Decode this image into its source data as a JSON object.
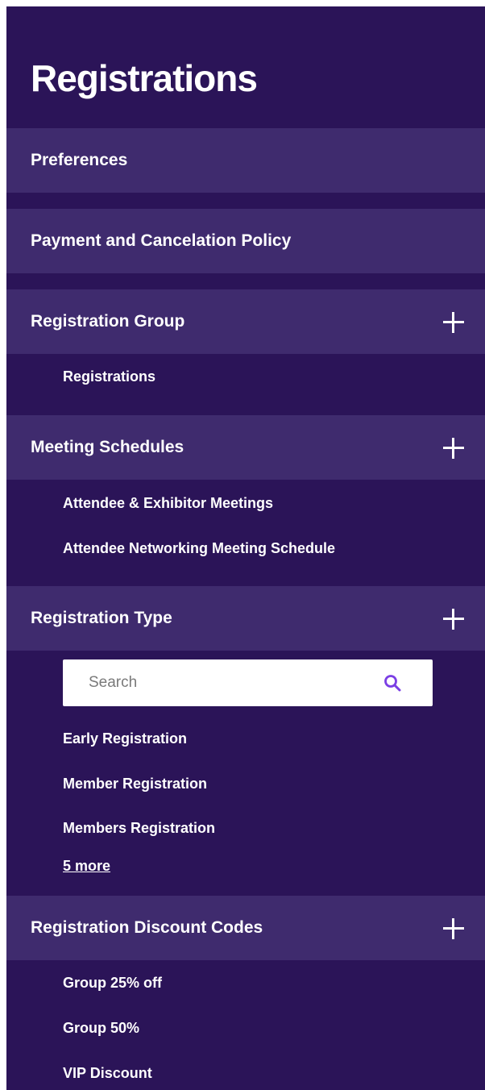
{
  "panel": {
    "title": "Registrations",
    "background_color": "#2b1458",
    "section_color": "#3f2b6e",
    "accent_color": "#7b3fe4"
  },
  "sections": {
    "preferences": {
      "label": "Preferences"
    },
    "payment": {
      "label": "Payment and Cancelation Policy"
    },
    "registration_group": {
      "label": "Registration Group",
      "expand_icon": "plus-icon",
      "items": [
        "Registrations"
      ]
    },
    "meeting_schedules": {
      "label": "Meeting Schedules",
      "expand_icon": "plus-icon",
      "items": [
        "Attendee & Exhibitor Meetings",
        "Attendee Networking Meeting Schedule"
      ]
    },
    "registration_type": {
      "label": "Registration Type",
      "expand_icon": "plus-icon",
      "search_placeholder": "Search",
      "search_icon": "search-icon",
      "items": [
        "Early Registration",
        "Member Registration",
        "Members Registration"
      ],
      "more_link": "5 more"
    },
    "discount_codes": {
      "label": "Registration Discount Codes",
      "expand_icon": "plus-icon",
      "items": [
        "Group 25% off",
        "Group 50%",
        "VIP Discount"
      ]
    }
  }
}
